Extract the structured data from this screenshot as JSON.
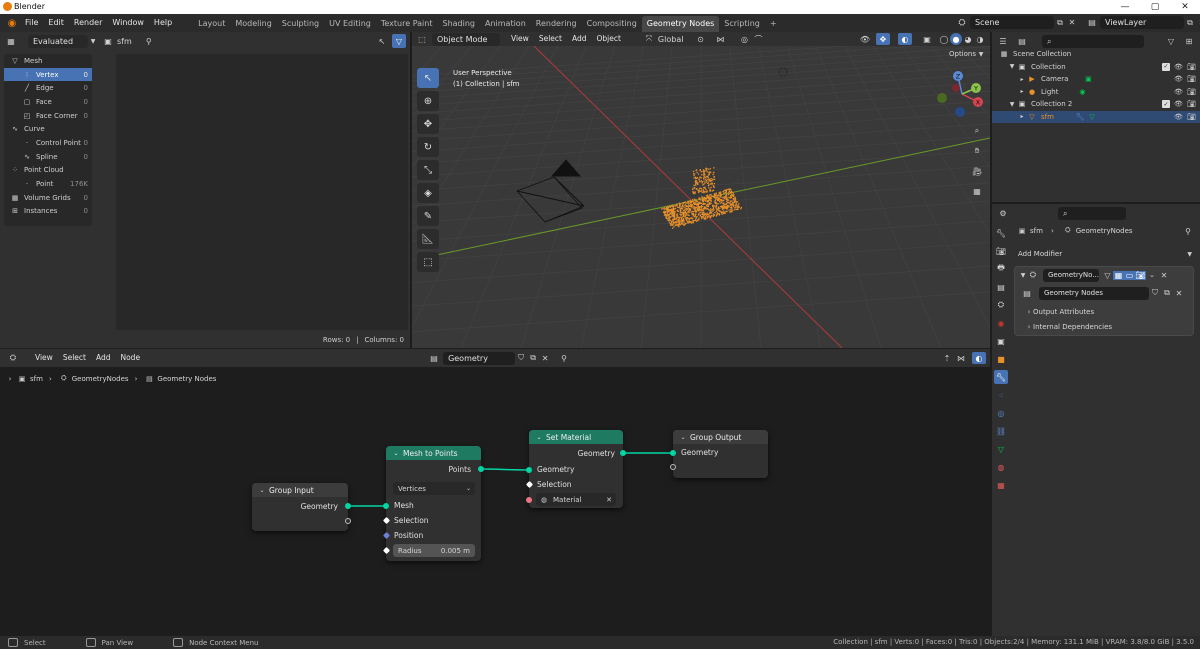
{
  "window": {
    "title": "Blender",
    "min": "—",
    "max": "▢",
    "close": "✕"
  },
  "menu": [
    "File",
    "Edit",
    "Render",
    "Window",
    "Help"
  ],
  "workspaces": [
    {
      "label": "Layout",
      "active": false
    },
    {
      "label": "Modeling",
      "active": false
    },
    {
      "label": "Sculpting",
      "active": false
    },
    {
      "label": "UV Editing",
      "active": false
    },
    {
      "label": "Texture Paint",
      "active": false
    },
    {
      "label": "Shading",
      "active": false
    },
    {
      "label": "Animation",
      "active": false
    },
    {
      "label": "Rendering",
      "active": false
    },
    {
      "label": "Compositing",
      "active": false
    },
    {
      "label": "Geometry Nodes",
      "active": true
    },
    {
      "label": "Scripting",
      "active": false
    }
  ],
  "add_workspace": "+",
  "scene": {
    "label": "Scene",
    "view_layer": "ViewLayer"
  },
  "spreadsheet": {
    "mode": "Evaluated",
    "object": "sfm",
    "items": [
      {
        "label": "Mesh",
        "count": "",
        "level": 0,
        "icon": "▽",
        "selected": false
      },
      {
        "label": "Vertex",
        "count": "0",
        "level": 1,
        "icon": "⁝",
        "selected": true
      },
      {
        "label": "Edge",
        "count": "0",
        "level": 1,
        "icon": "╱",
        "selected": false
      },
      {
        "label": "Face",
        "count": "0",
        "level": 1,
        "icon": "▢",
        "selected": false
      },
      {
        "label": "Face Corner",
        "count": "0",
        "level": 1,
        "icon": "◰",
        "selected": false
      },
      {
        "label": "Curve",
        "count": "",
        "level": 0,
        "icon": "∿",
        "selected": false
      },
      {
        "label": "Control Point",
        "count": "0",
        "level": 1,
        "icon": "·",
        "selected": false
      },
      {
        "label": "Spline",
        "count": "0",
        "level": 1,
        "icon": "∿",
        "selected": false
      },
      {
        "label": "Point Cloud",
        "count": "",
        "level": 0,
        "icon": "⁘",
        "selected": false
      },
      {
        "label": "Point",
        "count": "176K",
        "level": 1,
        "icon": "·",
        "selected": false
      },
      {
        "label": "Volume Grids",
        "count": "0",
        "level": 0,
        "icon": "▦",
        "selected": false
      },
      {
        "label": "Instances",
        "count": "0",
        "level": 0,
        "icon": "⊞",
        "selected": false
      }
    ],
    "rows": "Rows: 0",
    "separator": "|",
    "columns": "Columns: 0"
  },
  "viewport": {
    "mode": "Object Mode",
    "menus": [
      "View",
      "Select",
      "Add",
      "Object"
    ],
    "transform": "Global",
    "perspective": "User Perspective",
    "collection": "(1) Collection | sfm",
    "options": "Options",
    "axis_x": "X",
    "axis_y": "Y",
    "axis_z": "Z"
  },
  "outliner": {
    "rows": [
      {
        "label": "Scene Collection",
        "indent": 0,
        "icon": "▦",
        "selected": false
      },
      {
        "label": "Collection",
        "indent": 1,
        "icon": "▣",
        "selected": false
      },
      {
        "label": "Camera",
        "indent": 2,
        "icon": "▶",
        "selected": false
      },
      {
        "label": "Light",
        "indent": 2,
        "icon": "●",
        "selected": false
      },
      {
        "label": "Collection 2",
        "indent": 1,
        "icon": "▣",
        "selected": false
      },
      {
        "label": "sfm",
        "indent": 2,
        "icon": "▽",
        "selected": true
      }
    ]
  },
  "properties": {
    "breadcrumb": [
      "sfm",
      "GeometryNodes"
    ],
    "add_modifier": "Add Modifier",
    "modifier_name": "GeometryNo...",
    "node_group": "Geometry Nodes",
    "sections": [
      "Output Attributes",
      "Internal Dependencies"
    ]
  },
  "node_editor": {
    "menus": [
      "View",
      "Select",
      "Add",
      "Node"
    ],
    "node_group": "Geometry Nodes",
    "breadcrumb": [
      "sfm",
      "GeometryNodes",
      "Geometry Nodes"
    ],
    "nodes": {
      "group_input": {
        "title": "Group Input",
        "out": "Geometry"
      },
      "mesh_to_points": {
        "title": "Mesh to Points",
        "out": "Points",
        "mode": "Vertices",
        "inputs": [
          "Mesh",
          "Selection",
          "Position"
        ],
        "radius_label": "Radius",
        "radius_value": "0.005 m"
      },
      "set_material": {
        "title": "Set Material",
        "out": "Geometry",
        "inputs": [
          "Geometry",
          "Selection"
        ],
        "material": "Material"
      },
      "group_output": {
        "title": "Group Output",
        "in": "Geometry"
      }
    }
  },
  "status": {
    "left": [
      {
        "icon": "mouse-left-icon",
        "label": "Select"
      },
      {
        "icon": "mouse-middle-icon",
        "label": "Pan View"
      },
      {
        "icon": "mouse-right-icon",
        "label": "Node Context Menu"
      }
    ],
    "right": "Collection | sfm | Verts:0 | Faces:0 | Tris:0 | Objects:2/4 | Memory: 131.1 MiB | VRAM: 3.8/8.0 GiB | 3.5.0"
  },
  "colors": {
    "accent": "#4772b3",
    "geometry_socket": "#00d6a3",
    "node_header_green": "#1f7a62",
    "point_cloud": "#e8902a",
    "grid_x_axis": "#b03a3a",
    "grid_y_axis": "#6a9a2a"
  }
}
